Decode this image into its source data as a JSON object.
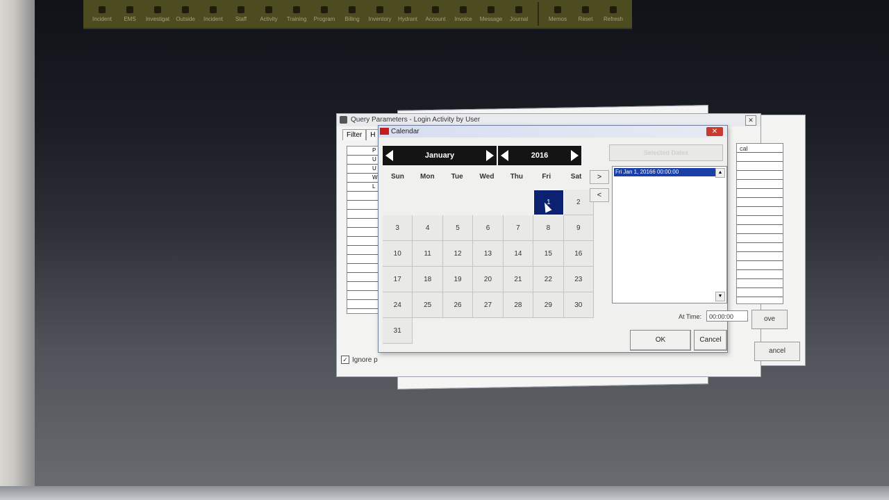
{
  "toolbar": {
    "items": [
      "Incident",
      "EMS",
      "Investigat",
      "Outside",
      "Incident",
      "Staff",
      "Activity",
      "Training",
      "Program",
      "Billing",
      "Inventory",
      "Hydrant",
      "Account",
      "Invoice",
      "Message",
      "Journal"
    ],
    "extra": [
      "Memos",
      "Reset",
      "Refresh"
    ]
  },
  "query_window": {
    "title": "Query Parameters - Login Activity by User",
    "tabs": [
      "Filter",
      "H"
    ],
    "grid_rows": [
      "P",
      "U",
      "U",
      "W",
      "L"
    ],
    "ignore_label": "Ignore p",
    "close": "✕",
    "right_col_label": "cal",
    "remove_label": "ove",
    "cancel_label": "ancel"
  },
  "calendar": {
    "title": "Calendar",
    "close": "✕",
    "month": "January",
    "year": "2016",
    "weekdays": [
      "Sun",
      "Mon",
      "Tue",
      "Wed",
      "Thu",
      "Fri",
      "Sat"
    ],
    "selected_day": "1",
    "add_arrow": ">",
    "remove_arrow": "<",
    "selected_dates_label": "Selected Dates",
    "selected_dates": [
      "Fri Jan 1, 20166 00:00:00"
    ],
    "at_time_label": "At Time:",
    "at_time_value": "00:00:00",
    "ok_label": "OK",
    "cancel_label": "Cancel"
  }
}
